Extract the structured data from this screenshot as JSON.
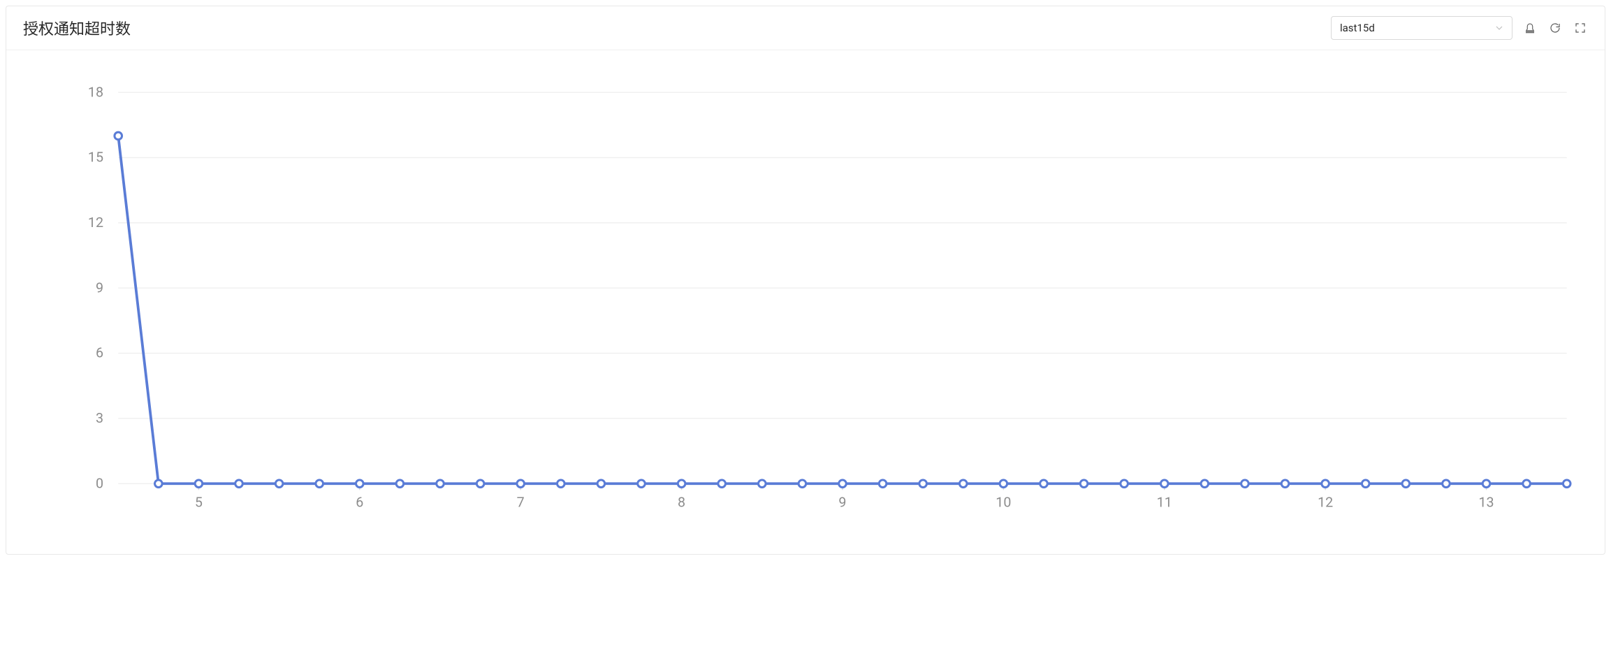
{
  "header": {
    "title": "授权通知超时数",
    "select_value": "last15d"
  },
  "chart_data": {
    "type": "line",
    "title": "授权通知超时数",
    "xlabel": "",
    "ylabel": "",
    "ylim": [
      0,
      18
    ],
    "y_ticks": [
      0,
      3,
      6,
      9,
      12,
      15,
      18
    ],
    "x_ticks_major": [
      5,
      6,
      7,
      8,
      9,
      10,
      11,
      12,
      13
    ],
    "x": [
      4.5,
      4.75,
      5,
      5.25,
      5.5,
      5.75,
      6,
      6.25,
      6.5,
      6.75,
      7,
      7.25,
      7.5,
      7.75,
      8,
      8.25,
      8.5,
      8.75,
      9,
      9.25,
      9.5,
      9.75,
      10,
      10.25,
      10.5,
      10.75,
      11,
      11.25,
      11.5,
      11.75,
      12,
      12.25,
      12.5,
      12.75,
      13,
      13.25,
      13.5
    ],
    "values": [
      16,
      0,
      0,
      0,
      0,
      0,
      0,
      0,
      0,
      0,
      0,
      0,
      0,
      0,
      0,
      0,
      0,
      0,
      0,
      0,
      0,
      0,
      0,
      0,
      0,
      0,
      0,
      0,
      0,
      0,
      0,
      0,
      0,
      0,
      0,
      0,
      0
    ]
  }
}
